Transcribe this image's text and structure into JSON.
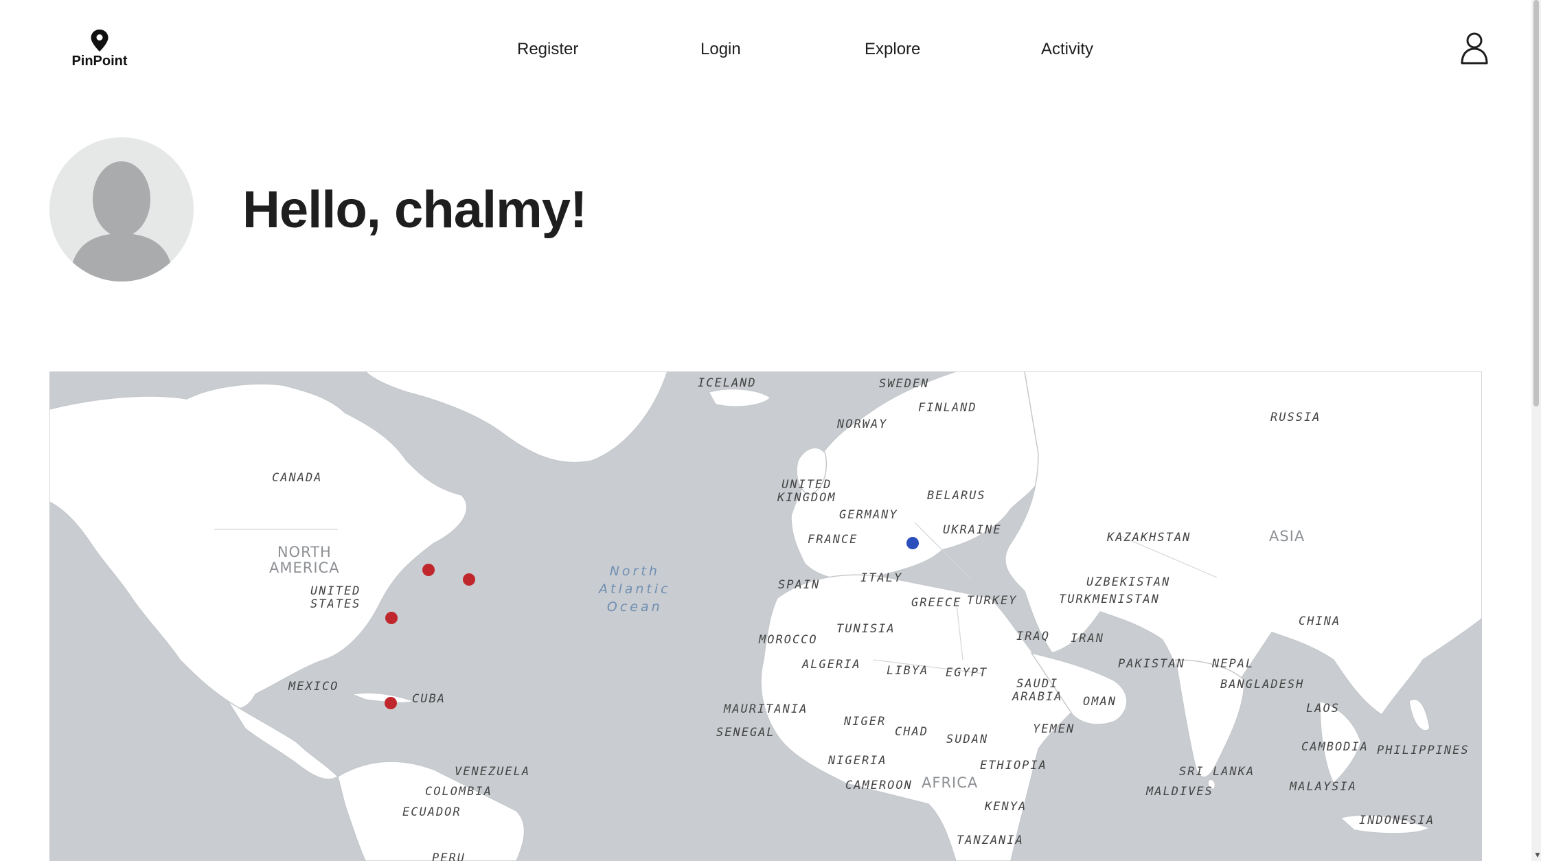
{
  "header": {
    "brand": "PinPoint",
    "nav": [
      "Register",
      "Login",
      "Explore",
      "Activity"
    ]
  },
  "profile": {
    "greeting": "Hello, chalmy!"
  },
  "map": {
    "labels": {
      "iceland": "ICELAND",
      "sweden": "SWEDEN",
      "finland": "FINLAND",
      "norway": "NORWAY",
      "russia": "RUSSIA",
      "canada": "CANADA",
      "north_america": "NORTH\nAMERICA",
      "united_states": "UNITED\nSTATES",
      "united_kingdom": "UNITED\nKINGDOM",
      "belarus": "BELARUS",
      "germany": "GERMANY",
      "ukraine": "UKRAINE",
      "france": "FRANCE",
      "kazakhstan": "KAZAKHSTAN",
      "asia": "ASIA",
      "north_atlantic": "North\nAtlantic\nOcean",
      "spain": "SPAIN",
      "italy": "ITALY",
      "uzbekistan": "UZBEKISTAN",
      "greece": "GREECE",
      "turkey": "TURKEY",
      "turkmenistan": "TURKMENISTAN",
      "china": "CHINA",
      "tunisia": "TUNISIA",
      "morocco": "MOROCCO",
      "iraq": "IRAQ",
      "iran": "IRAN",
      "algeria": "ALGERIA",
      "libya": "LIBYA",
      "egypt": "EGYPT",
      "pakistan": "PAKISTAN",
      "nepal": "NEPAL",
      "mexico": "MEXICO",
      "saudi_arabia": "SAUDI\nARABIA",
      "bangladesh": "BANGLADESH",
      "oman": "OMAN",
      "cuba": "CUBA",
      "mauritania": "MAURITANIA",
      "laos": "LAOS",
      "niger": "NIGER",
      "chad": "CHAD",
      "senegal": "SENEGAL",
      "yemen": "YEMEN",
      "sudan": "SUDAN",
      "cambodia": "CAMBODIA",
      "philippines": "PHILIPPINES",
      "nigeria": "NIGERIA",
      "ethiopia": "ETHIOPIA",
      "venezuela": "VENEZUELA",
      "sri_lanka": "SRI LANKA",
      "cameroon": "CAMEROON",
      "africa": "AFRICA",
      "colombia": "COLOMBIA",
      "maldives": "MALDIVES",
      "malaysia": "MALAYSIA",
      "kenya": "KENYA",
      "ecuador": "ECUADOR",
      "indonesia": "INDONESIA",
      "tanzania": "TANZANIA",
      "peru": "PERU"
    },
    "pin_colors": {
      "visited": "#c0272d",
      "current": "#2a4fbd"
    }
  }
}
